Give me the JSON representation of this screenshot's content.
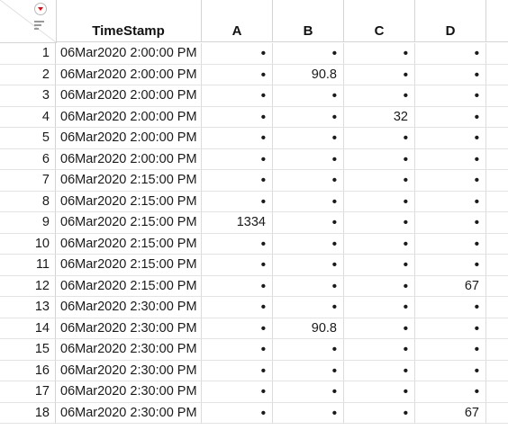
{
  "table": {
    "columns": [
      "TimeStamp",
      "A",
      "B",
      "C",
      "D"
    ],
    "missing_glyph": "•",
    "rows": [
      {
        "n": "1",
        "ts": "06Mar2020 2:00:00 PM",
        "a": "•",
        "b": "•",
        "c": "•",
        "d": "•"
      },
      {
        "n": "2",
        "ts": "06Mar2020 2:00:00 PM",
        "a": "•",
        "b": "90.8",
        "c": "•",
        "d": "•"
      },
      {
        "n": "3",
        "ts": "06Mar2020 2:00:00 PM",
        "a": "•",
        "b": "•",
        "c": "•",
        "d": "•"
      },
      {
        "n": "4",
        "ts": "06Mar2020 2:00:00 PM",
        "a": "•",
        "b": "•",
        "c": "32",
        "d": "•"
      },
      {
        "n": "5",
        "ts": "06Mar2020 2:00:00 PM",
        "a": "•",
        "b": "•",
        "c": "•",
        "d": "•"
      },
      {
        "n": "6",
        "ts": "06Mar2020 2:00:00 PM",
        "a": "•",
        "b": "•",
        "c": "•",
        "d": "•"
      },
      {
        "n": "7",
        "ts": "06Mar2020 2:15:00 PM",
        "a": "•",
        "b": "•",
        "c": "•",
        "d": "•"
      },
      {
        "n": "8",
        "ts": "06Mar2020 2:15:00 PM",
        "a": "•",
        "b": "•",
        "c": "•",
        "d": "•"
      },
      {
        "n": "9",
        "ts": "06Mar2020 2:15:00 PM",
        "a": "1334",
        "b": "•",
        "c": "•",
        "d": "•"
      },
      {
        "n": "10",
        "ts": "06Mar2020 2:15:00 PM",
        "a": "•",
        "b": "•",
        "c": "•",
        "d": "•"
      },
      {
        "n": "11",
        "ts": "06Mar2020 2:15:00 PM",
        "a": "•",
        "b": "•",
        "c": "•",
        "d": "•"
      },
      {
        "n": "12",
        "ts": "06Mar2020 2:15:00 PM",
        "a": "•",
        "b": "•",
        "c": "•",
        "d": "67"
      },
      {
        "n": "13",
        "ts": "06Mar2020 2:30:00 PM",
        "a": "•",
        "b": "•",
        "c": "•",
        "d": "•"
      },
      {
        "n": "14",
        "ts": "06Mar2020 2:30:00 PM",
        "a": "•",
        "b": "90.8",
        "c": "•",
        "d": "•"
      },
      {
        "n": "15",
        "ts": "06Mar2020 2:30:00 PM",
        "a": "•",
        "b": "•",
        "c": "•",
        "d": "•"
      },
      {
        "n": "16",
        "ts": "06Mar2020 2:30:00 PM",
        "a": "•",
        "b": "•",
        "c": "•",
        "d": "•"
      },
      {
        "n": "17",
        "ts": "06Mar2020 2:30:00 PM",
        "a": "•",
        "b": "•",
        "c": "•",
        "d": "•"
      },
      {
        "n": "18",
        "ts": "06Mar2020 2:30:00 PM",
        "a": "•",
        "b": "•",
        "c": "•",
        "d": "67"
      }
    ]
  },
  "icons": {
    "table_menu": "red-triangle-menu-icon",
    "sort": "sort-lines-icon"
  },
  "colors": {
    "menu_triangle": "#d0121b",
    "grid_line": "#d4d4d4",
    "sort_icon": "#9a9a9a"
  }
}
